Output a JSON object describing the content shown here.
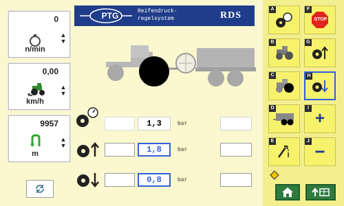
{
  "left_panels": [
    {
      "value": "0",
      "unit": "n/min",
      "icon": "rpm-dial-icon"
    },
    {
      "value": "0,00",
      "unit": "km/h",
      "icon": "tractor-speed-icon"
    },
    {
      "value": "9957",
      "unit": "m",
      "icon": "distance-icon"
    }
  ],
  "header": {
    "brand": "PTG",
    "subtitle_line1": "Reifendruck-",
    "subtitle_line2": "regelsystem",
    "product": "RDS"
  },
  "pressures": {
    "unit": "bar",
    "current": "1,3",
    "target_high": "1,8",
    "target_low": "0,8"
  },
  "softkeys_left": [
    {
      "letter": "A",
      "icon": "tire-pressure-gauge-icon"
    },
    {
      "letter": "B",
      "icon": "tractor-icon"
    },
    {
      "letter": "C",
      "icon": "tractor-wheel-icon"
    },
    {
      "letter": "D",
      "icon": "trailer-icon"
    },
    {
      "letter": "E",
      "icon": "settings-wrench-icon"
    }
  ],
  "softkeys_right": [
    {
      "letter": "F",
      "label": "STOP",
      "icon": "stop-sign-icon"
    },
    {
      "letter": "G",
      "icon": "tire-up-icon"
    },
    {
      "letter": "H",
      "icon": "tire-down-icon"
    },
    {
      "letter": "I",
      "label": "+",
      "icon": "plus-icon"
    },
    {
      "letter": "J",
      "label": "−",
      "icon": "minus-icon"
    }
  ],
  "colors": {
    "background": "#fbf8cf",
    "header_blue": "#1f3d8a",
    "accent_blue": "#2e5fdc",
    "softkey_yellow": "#f7f26b",
    "bottom_green": "#2f7a3d",
    "stop_red": "#e0231c"
  }
}
